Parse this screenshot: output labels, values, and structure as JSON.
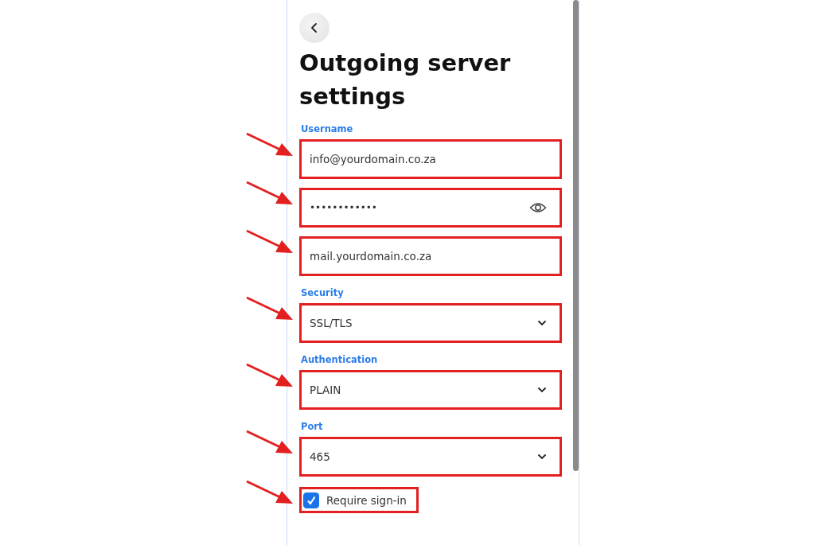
{
  "title": "Outgoing server settings",
  "fields": [
    {
      "kind": "text",
      "label": "Username",
      "value": "info@yourdomain.co.za",
      "highlighted": true
    },
    {
      "kind": "password",
      "value": "••••••••••••",
      "highlighted": true
    },
    {
      "kind": "text",
      "value": "mail.yourdomain.co.za",
      "highlighted": true
    },
    {
      "kind": "select",
      "label": "Security",
      "value": "SSL/TLS",
      "highlighted": true
    },
    {
      "kind": "select",
      "label": "Authentication",
      "value": "PLAIN",
      "highlighted": true
    },
    {
      "kind": "select",
      "label": "Port",
      "value": "465",
      "highlighted": true
    }
  ],
  "require_sign_in": {
    "label": "Require sign-in",
    "checked": true,
    "highlighted": true
  }
}
